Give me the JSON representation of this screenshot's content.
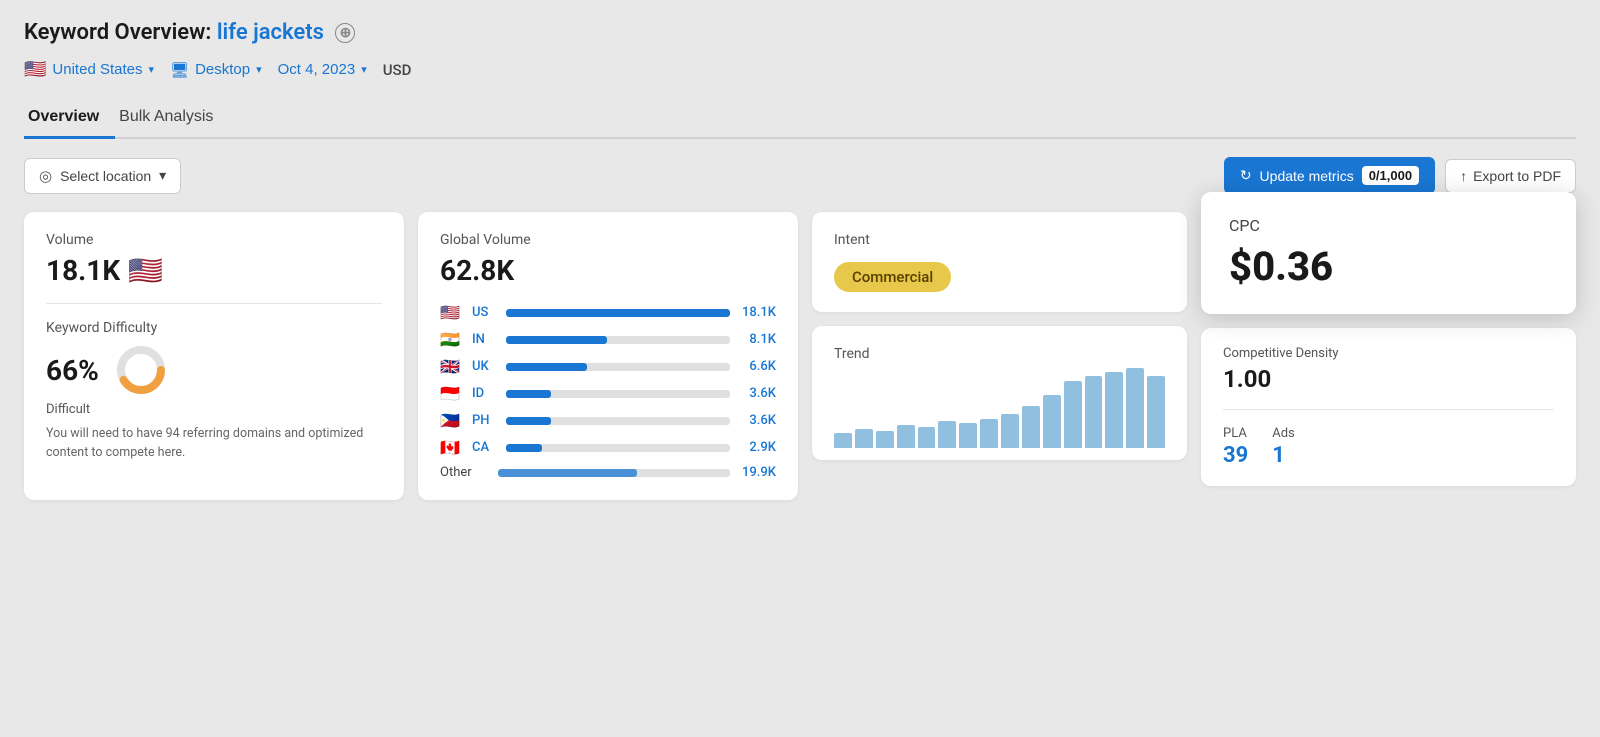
{
  "header": {
    "title_prefix": "Keyword Overview:",
    "title_keyword": "life jackets",
    "plus_icon": "⊕"
  },
  "filters": {
    "country": "United States",
    "country_flag": "🇺🇸",
    "device": "Desktop",
    "date": "Oct 4, 2023",
    "currency": "USD"
  },
  "tabs": [
    {
      "label": "Overview",
      "active": true
    },
    {
      "label": "Bulk Analysis",
      "active": false
    }
  ],
  "toolbar": {
    "select_location": "Select location",
    "update_metrics": "Update metrics",
    "count": "0/1,000",
    "export": "Export to PDF"
  },
  "volume_card": {
    "label": "Volume",
    "value": "18.1K",
    "flag": "🇺🇸",
    "kd_label": "Keyword Difficulty",
    "kd_value": "66%",
    "kd_difficulty": "Difficult",
    "kd_desc": "You will need to have 94 referring domains and optimized content to compete here.",
    "donut": {
      "value": 66,
      "color": "#f0a040",
      "bg_color": "#e0e0e0"
    }
  },
  "global_volume_card": {
    "label": "Global Volume",
    "value": "62.8K",
    "countries": [
      {
        "flag": "🇺🇸",
        "code": "US",
        "volume": "18.1K",
        "bar_pct": 100
      },
      {
        "flag": "🇮🇳",
        "code": "IN",
        "volume": "8.1K",
        "bar_pct": 45
      },
      {
        "flag": "🇬🇧",
        "code": "UK",
        "volume": "6.6K",
        "bar_pct": 36
      },
      {
        "flag": "🇮🇩",
        "code": "ID",
        "volume": "3.6K",
        "bar_pct": 20
      },
      {
        "flag": "🇵🇭",
        "code": "PH",
        "volume": "3.6K",
        "bar_pct": 20
      },
      {
        "flag": "🇨🇦",
        "code": "CA",
        "volume": "2.9K",
        "bar_pct": 16
      }
    ],
    "other_label": "Other",
    "other_volume": "19.9K",
    "other_bar_pct": 60
  },
  "intent_card": {
    "label": "Intent",
    "badge": "Commercial"
  },
  "trend_card": {
    "label": "Trend",
    "bars": [
      8,
      10,
      9,
      12,
      11,
      14,
      13,
      15,
      18,
      22,
      28,
      35,
      38,
      40,
      42,
      38
    ]
  },
  "cpc_card": {
    "label": "CPC",
    "value": "$0.36"
  },
  "right_bottom": {
    "comp_density_label": "Competitive Density",
    "comp_density_value": "1.00",
    "pla_label": "PLA",
    "pla_value": "39",
    "ads_label": "Ads",
    "ads_value": "1"
  }
}
